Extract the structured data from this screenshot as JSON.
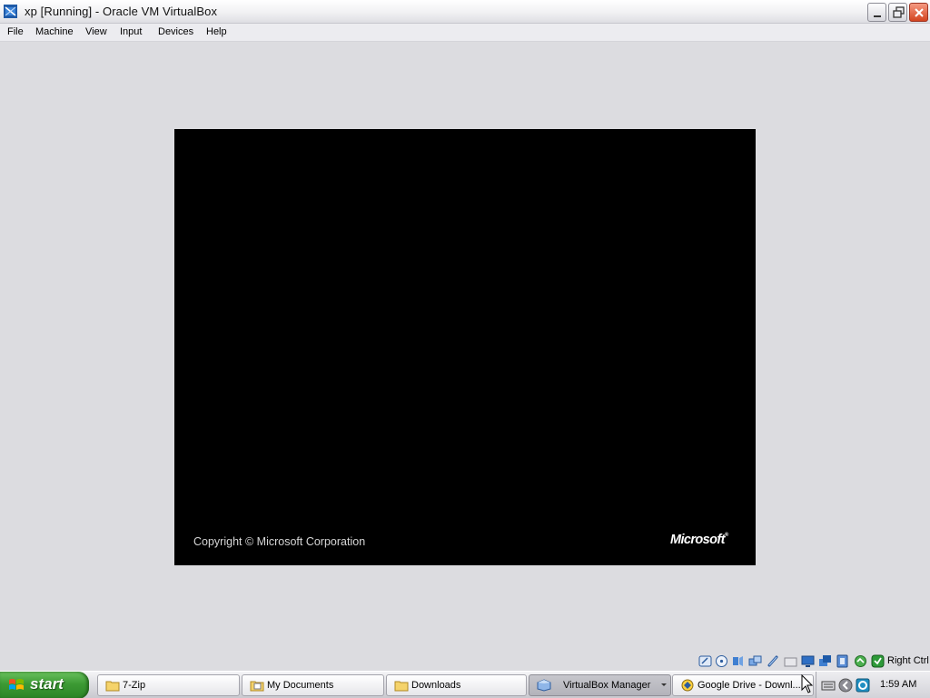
{
  "window": {
    "title": "xp [Running] - Oracle VM VirtualBox",
    "minimize_icon": "minimize-icon",
    "restore_icon": "restore-icon",
    "close_icon": "close-icon"
  },
  "menu": {
    "items": [
      "File",
      "Machine",
      "View",
      "Input",
      "Devices",
      "Help"
    ]
  },
  "vm": {
    "copyright": "Copyright © Microsoft Corporation",
    "logo": "Microsoft",
    "background_color": "#000000"
  },
  "statusbar": {
    "icons": [
      "hard-disk-icon",
      "optical-drive-icon",
      "audio-icon",
      "network-icon",
      "usb-icon",
      "shared-folders-icon",
      "display-icon",
      "video-capture-icon",
      "virtualization-icon",
      "mouse-integration-icon",
      "host-key-icon"
    ],
    "host_key": "Right Ctrl"
  },
  "taskbar": {
    "start_label": "start",
    "tasks": [
      {
        "label": "7-Zip",
        "icon": "folder-icon"
      },
      {
        "label": "My Documents",
        "icon": "documents-icon"
      },
      {
        "label": "Downloads",
        "icon": "folder-icon"
      },
      {
        "label": "VirtualBox Manager",
        "icon": "virtualbox-icon"
      },
      {
        "label": "Google Drive - Downl...",
        "icon": "browser-icon"
      }
    ],
    "clock": "1:59 AM"
  }
}
